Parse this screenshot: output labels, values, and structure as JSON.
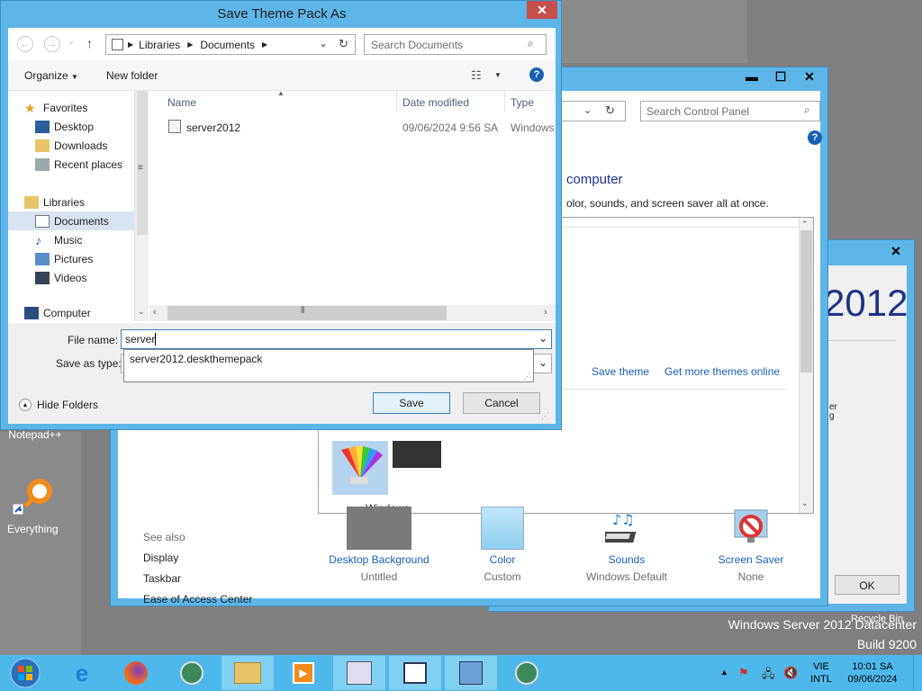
{
  "desktop": {
    "notepad_label": "Notepad++",
    "everything_label": "Everything",
    "os_line1": "Windows Server 2012 Datacenter",
    "os_line2": "Build 9200",
    "overlap_text": "Recycle Bin"
  },
  "control_panel": {
    "search_placeholder": "Search Control Panel",
    "heading_partial": "computer",
    "desc_partial": "olor, sounds, and screen saver all at once.",
    "save_theme": "Save theme",
    "get_more": "Get more themes online",
    "theme_name": "Windows",
    "see_also": {
      "title": "See also",
      "items": [
        "Display",
        "Taskbar",
        "Ease of Access Center"
      ]
    },
    "bottom_items": [
      {
        "label": "Desktop Background",
        "sub": "Untitled",
        "icon": "desktop-background-icon"
      },
      {
        "label": "Color",
        "sub": "Custom",
        "icon": "color-icon"
      },
      {
        "label": "Sounds",
        "sub": "Windows Default",
        "icon": "sounds-icon"
      },
      {
        "label": "Screen Saver",
        "sub": "None",
        "icon": "screen-saver-icon"
      }
    ]
  },
  "sys_dialog": {
    "logo_text": "2012",
    "frag1": "er",
    "frag2": "g",
    "ok": "OK"
  },
  "save_dialog": {
    "title": "Save Theme Pack As",
    "breadcrumb": [
      "Libraries",
      "Documents"
    ],
    "search_placeholder": "Search Documents",
    "organize": "Organize",
    "new_folder": "New folder",
    "nav": {
      "favorites": "Favorites",
      "fav_items": [
        "Desktop",
        "Downloads",
        "Recent places"
      ],
      "libraries": "Libraries",
      "lib_items": [
        "Documents",
        "Music",
        "Pictures",
        "Videos"
      ],
      "computer": "Computer"
    },
    "columns": {
      "name": "Name",
      "date": "Date modified",
      "type": "Type"
    },
    "files": [
      {
        "name": "server2012",
        "date": "09/06/2024 9:56 SA",
        "type": "Windows"
      }
    ],
    "file_name_label": "File name:",
    "file_name_value": "server",
    "autocomplete": "server2012.deskthemepack",
    "save_as_type_label": "Save as type:",
    "hide_folders": "Hide Folders",
    "save_btn": "Save",
    "cancel_btn": "Cancel"
  },
  "taskbar": {
    "lang1": "VIE",
    "lang2": "INTL",
    "time": "10:01 SA",
    "date": "09/06/2024"
  }
}
